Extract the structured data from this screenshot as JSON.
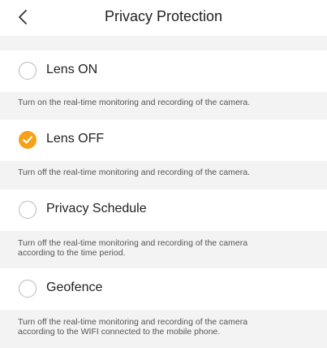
{
  "header": {
    "title": "Privacy Protection",
    "back_icon": "chevron-left-icon"
  },
  "options": [
    {
      "label": "Lens ON",
      "checked": false,
      "description": "Turn on the real-time monitoring and recording of the camera."
    },
    {
      "label": "Lens OFF",
      "checked": true,
      "description": "Turn off the real-time monitoring and recording of the camera."
    },
    {
      "label": "Privacy Schedule",
      "checked": false,
      "description": "Turn off the real-time monitoring and recording of the camera according to the time period."
    },
    {
      "label": "Geofence",
      "checked": false,
      "description": "Turn off the real-time monitoring and recording of the camera according to the WIFI connected to the mobile phone."
    }
  ],
  "colors": {
    "accent": "#f6a118",
    "section_background": "#f3f3f3",
    "radio_border": "#b9b9b9"
  }
}
